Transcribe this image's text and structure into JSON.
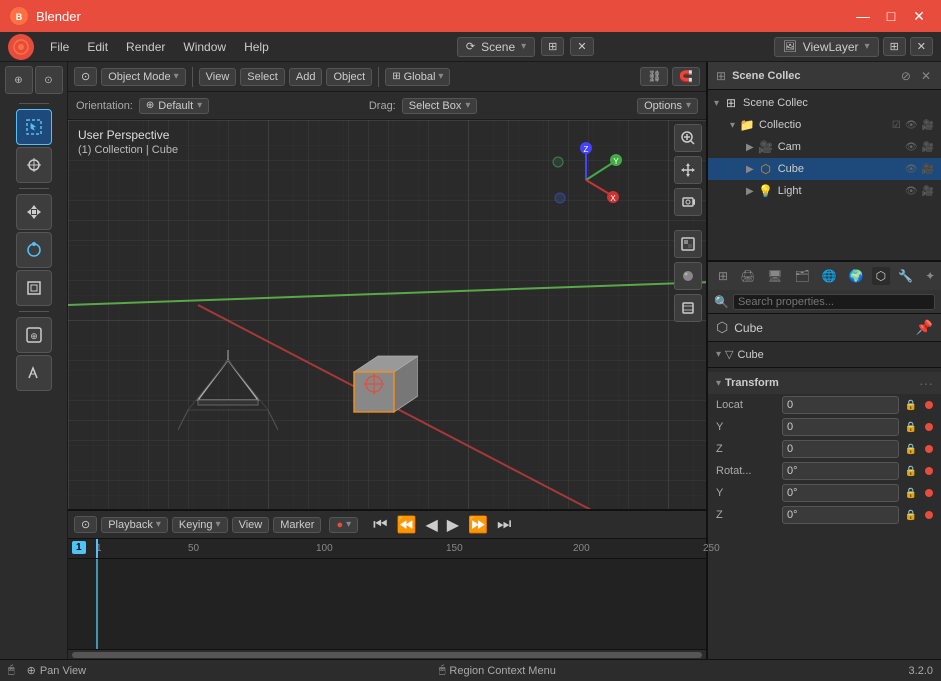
{
  "titlebar": {
    "logo": "B",
    "title": "Blender",
    "minimize": "—",
    "maximize": "□",
    "close": "✕"
  },
  "menubar": {
    "items": [
      "File",
      "Edit",
      "Render",
      "Window",
      "Help"
    ],
    "scene_label": "Scene",
    "viewlayer_label": "ViewLayer"
  },
  "viewport_header": {
    "mode_label": "Object Mode",
    "view_label": "View",
    "select_label": "Select",
    "add_label": "Add",
    "object_label": "Object",
    "global_label": "Global"
  },
  "viewport_subheader": {
    "orientation_label": "Orientation:",
    "default_label": "Default",
    "drag_label": "Drag:",
    "select_box_label": "Select Box",
    "options_label": "Options"
  },
  "viewport": {
    "perspective_label": "User Perspective",
    "collection_label": "(1) Collection | Cube"
  },
  "timeline": {
    "playback_label": "Playback",
    "keying_label": "Keying",
    "view_label": "View",
    "marker_label": "Marker",
    "frame_current": "1",
    "rulers": [
      "1",
      "50",
      "100",
      "150",
      "200",
      "250"
    ]
  },
  "statusbar": {
    "pan_view_label": "Pan View",
    "region_context_label": "Region Context Menu",
    "version": "3.2.0"
  },
  "outliner": {
    "title": "Scene Collec",
    "items": [
      {
        "name": "Collectio",
        "icon": "📁",
        "depth": 0,
        "has_arrow": true,
        "checked": true
      },
      {
        "name": "Cam",
        "icon": "🎥",
        "depth": 1,
        "has_arrow": true
      },
      {
        "name": "Cube",
        "icon": "🔶",
        "depth": 1,
        "has_arrow": true
      },
      {
        "name": "Light",
        "icon": "💡",
        "depth": 1,
        "has_arrow": true
      }
    ]
  },
  "properties": {
    "tabs": [
      "scene",
      "render",
      "output",
      "view_layer",
      "scene2",
      "world",
      "object",
      "modifier",
      "particles",
      "physics",
      "constraints",
      "object_data",
      "material"
    ],
    "object_name": "Cube",
    "data_name": "Cube",
    "sections": {
      "transform": {
        "title": "Transform",
        "fields": {
          "location": {
            "label": "Locat",
            "x": "0",
            "y": "0",
            "z": "0"
          },
          "rotation": {
            "label": "Rotat...",
            "x": "0°",
            "y": "0°",
            "z": "0°"
          }
        }
      }
    }
  }
}
